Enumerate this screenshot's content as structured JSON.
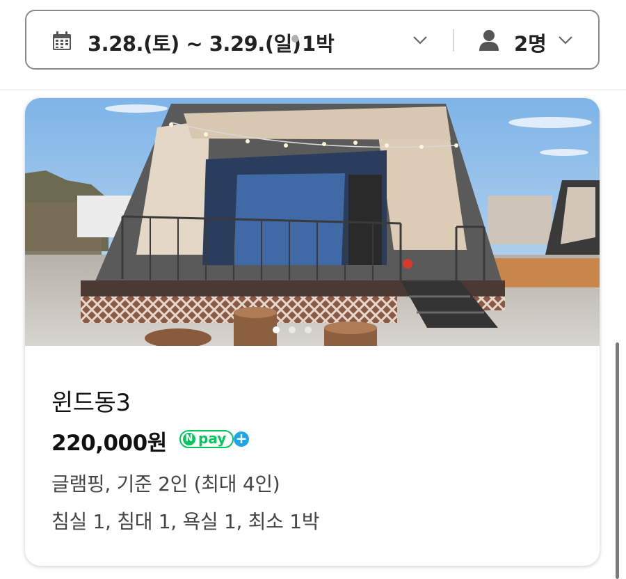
{
  "search": {
    "date_range": "3.28.(토) ~ 3.29.(일)",
    "separator": "•",
    "nights": "1박",
    "guests": "2명"
  },
  "listing": {
    "name": "윈드동3",
    "price": "220,000원",
    "npay_n": "N",
    "npay_word": "pay",
    "npay_plus": "+",
    "type_capacity": "글램핑, 기준 2인 (최대 4인)",
    "details": "침실 1, 침대 1, 욕실 1, 최소 1박",
    "photo_count": 3,
    "photo_current": 1
  },
  "colors": {
    "npay_green": "#03c75a",
    "npay_plus_blue": "#1ea7e8",
    "border": "#8a8a8a"
  },
  "icons": {
    "date": "calendar-icon",
    "date_toggle": "chevron-down-icon",
    "guest": "person-icon",
    "guest_toggle": "chevron-down-icon"
  }
}
